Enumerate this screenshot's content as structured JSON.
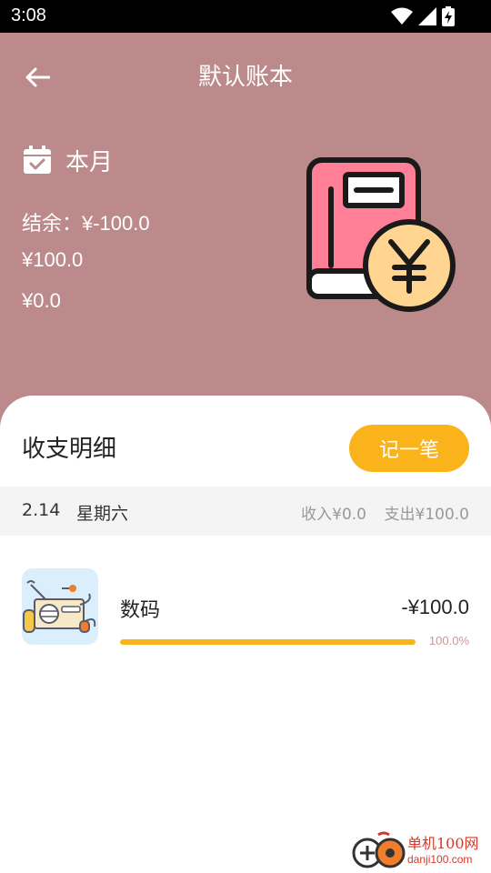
{
  "status_bar": {
    "time": "3:08"
  },
  "header": {
    "title": "默认账本",
    "period_label": "本月",
    "balance": "结余：¥-100.0",
    "expense_total": "¥100.0",
    "income_total": "¥0.0"
  },
  "details": {
    "section_title": "收支明细",
    "add_button_label": "记一笔",
    "groups": [
      {
        "date": "2.14",
        "weekday": "星期六",
        "income": "收入¥0.0",
        "expense": "支出¥100.0",
        "items": [
          {
            "category": "数码",
            "amount": "-¥100.0",
            "percent_text": "100.0%",
            "percent_value": 100
          }
        ]
      }
    ]
  },
  "watermark": {
    "line1": "单机100网",
    "line2": "danji100.com"
  },
  "colors": {
    "header_bg": "#bc8a8a",
    "accent": "#fbb31b",
    "date_bar_bg": "#f4f4f4"
  }
}
